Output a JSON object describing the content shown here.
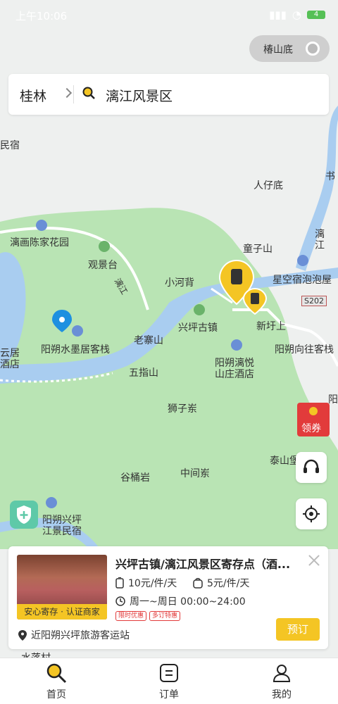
{
  "status_bar": {
    "time": "上午10:06",
    "battery": "4"
  },
  "location_chip": {
    "label": "椿山底"
  },
  "search": {
    "city": "桂林",
    "query": "漓江风景区"
  },
  "map_labels": [
    "民宿",
    "书",
    "人仔底",
    "漓画陈家花园",
    "童子山",
    "漓",
    "江",
    "观景台",
    "星空宿泡泡屋",
    "小河背",
    "S202",
    "兴坪古镇",
    "新圩上",
    "老寨山",
    "阳朔水墨居客栈",
    "阳朔向往客栈",
    "阳朔漓悦",
    "山庄酒店",
    "五指山",
    "狮子岽",
    "泰山堡",
    "谷桶岩",
    "中间岽",
    "阳朔兴坪",
    "江景民宿",
    "水落村",
    "云居",
    "酒店",
    "阳",
    "漓江"
  ],
  "coupon": {
    "label": "领券"
  },
  "card": {
    "title": "兴坪古镇/漓江风景区寄存点（酒...",
    "badge": "安心寄存 · 认证商家",
    "price_large": "10元/件/天",
    "price_small": "5元/件/天",
    "hours": "周一~周日 00:00~24:00",
    "tags": [
      "限时优惠",
      "多订特惠"
    ],
    "address": "近阳朔兴坪旅游客运站",
    "book_button": "预订"
  },
  "tabs": [
    {
      "label": "首页",
      "icon": "search-icon"
    },
    {
      "label": "订单",
      "icon": "order-icon"
    },
    {
      "label": "我的",
      "icon": "user-icon"
    }
  ],
  "colors": {
    "accent": "#f4c524",
    "river": "#a9cdf0",
    "park": "#b9e4b4",
    "marker_blue": "#1e90e0",
    "tag_red": "#e23b3b"
  }
}
